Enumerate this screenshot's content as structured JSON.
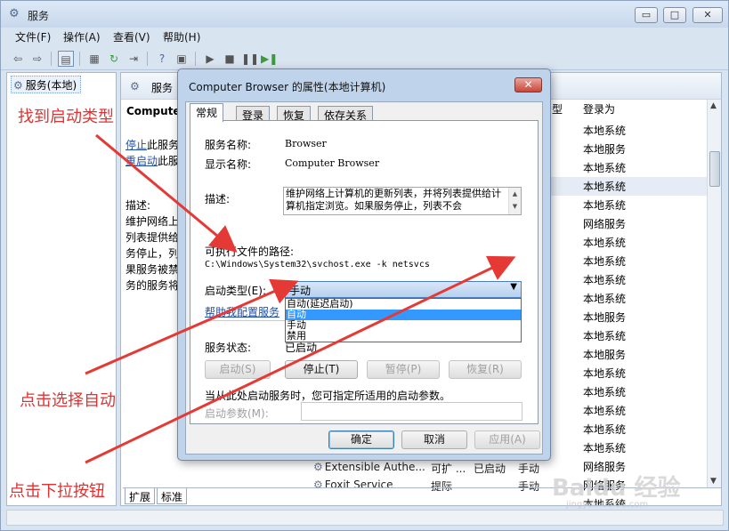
{
  "window": {
    "title": "服务",
    "controls": {
      "minimize": "▭",
      "maximize": "□",
      "close": "✕"
    }
  },
  "menu": [
    "文件(F)",
    "操作(A)",
    "查看(V)",
    "帮助(H)"
  ],
  "tree": {
    "item": "服务(本地)"
  },
  "pane": {
    "header": "服务",
    "selected_service": "Computer",
    "stop_link": "停止",
    "stop_rest": "此服务",
    "restart_link": "重启动",
    "restart_rest": "此服",
    "desc_label": "描述:",
    "desc_lines": [
      "维护网络上",
      "列表提供给",
      "务停止，列",
      "果服务被禁",
      "务的服务将"
    ],
    "col_type_tail": "型",
    "col_logon": "登录为",
    "logon_values": [
      "本地系统",
      "本地服务",
      "本地系统",
      "本地系统",
      "本地系统",
      "网络服务",
      "本地系统",
      "本地系统",
      "本地系统",
      "本地系统",
      "本地服务",
      "本地系统",
      "本地服务",
      "本地系统",
      "本地系统",
      "本地系统",
      "本地系统",
      "本地系统",
      "网络服务",
      "网络服务",
      "本地系统",
      "本地系统"
    ],
    "bottom_services": [
      {
        "name": "Extensible Authe...",
        "desc": "可扩 ...",
        "status": "已启动",
        "startup": "手动"
      },
      {
        "name": "Foxit Service",
        "desc": "提际",
        "status": "",
        "startup": "手动"
      }
    ],
    "tabs": [
      "扩展",
      "标准"
    ]
  },
  "dialog": {
    "title": "Computer Browser 的属性(本地计算机)",
    "tabs": [
      "常规",
      "登录",
      "恢复",
      "依存关系"
    ],
    "service_name_label": "服务名称:",
    "service_name": "Browser",
    "display_name_label": "显示名称:",
    "display_name": "Computer Browser",
    "description_label": "描述:",
    "description": "维护网络上计算机的更新列表，并将列表提供给计算机指定浏览。如果服务停止，列表不会",
    "exe_path_label": "可执行文件的路径:",
    "exe_path": "C:\\Windows\\System32\\svchost.exe -k netsvcs",
    "startup_type_label": "启动类型(E):",
    "startup_type_value": "手动",
    "options": [
      "自动(延迟启动)",
      "自动",
      "手动",
      "禁用"
    ],
    "help_link": "帮助我配置服务",
    "status_label": "服务状态:",
    "status_value": "已启动",
    "buttons": {
      "start": "启动(S)",
      "stop": "停止(T)",
      "pause": "暂停(P)",
      "resume": "恢复(R)"
    },
    "hint": "当从此处启动服务时，您可指定所适用的启动参数。",
    "param_label": "启动参数(M):",
    "ok": "确定",
    "cancel": "取消",
    "apply": "应用(A)"
  },
  "annotations": {
    "find_startup": "找到启动类型",
    "choose_auto": "点击选择自动",
    "click_dropdown": "点击下拉按钮",
    "arrow_color": "#e53935"
  },
  "watermark": {
    "brand": "Baidu 经验",
    "url": "jingyan.baidu.com"
  }
}
